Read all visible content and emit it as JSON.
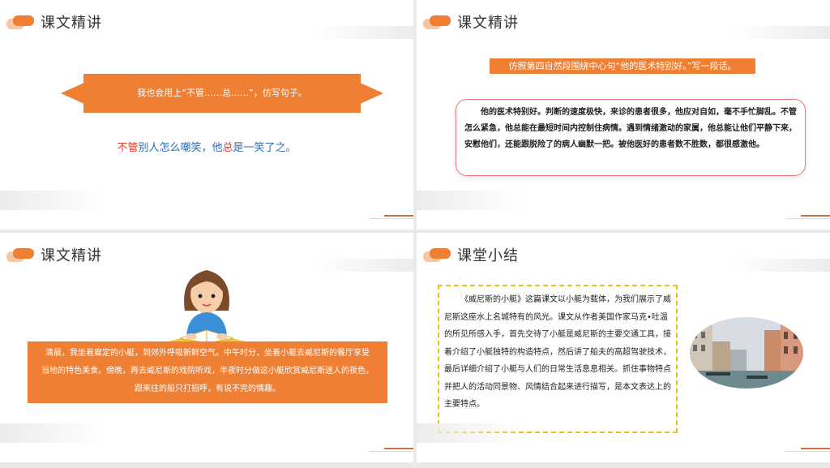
{
  "slides": [
    {
      "title": "课文精讲",
      "banner": "我也会用上“不管……总……”，仿写句子。",
      "sentence": {
        "p1": "不管",
        "p2": "别人怎么嘲笑，他",
        "p3": "总",
        "p4": "是一笑了之。"
      }
    },
    {
      "title": "课文精讲",
      "prompt": "仿照第四自然段围绕中心句“他的医术特别好。”写一段话。",
      "paragraph": "他的医术特别好。判断的速度极快，来诊的患者很多，他应对自如，毫不手忙脚乱。不管怎么紧急，他总能在最短时间内控制住病情。遇到情绪激动的家属，他总能让他们平静下来，安慰他们，还能跟脱险了的病人幽默一把。被他医好的患者数不胜数，都很感激他。"
    },
    {
      "title": "课文精讲",
      "passage": {
        "line1": "清晨，我坐着雇定的小艇，到郊外呼吸新鲜空气。中午时分，坐着小艇去威尼斯的餐厅享受",
        "line2": "当地的特色美食。傍晚，再去威尼斯的戏院听戏，半夜时分做这小艇欣赏威尼斯迷人的夜色，",
        "line3": "跟来往的船只打招呼，有说不完的情趣。"
      }
    },
    {
      "title": "课堂小结",
      "summary": "《威尼斯的小艇》这篇课文以小艇为载体，为我们展示了威尼斯这座水上名城特有的风光。课文从作者美国作家马克•吐温的所见所感入手，首先交待了小艇是威尼斯的主要交通工具，接着介绍了小艇独特的构造特点，然后讲了船夫的高超驾驶技术，最后详细介绍了小艇与人们的日常生活息息相关。抓住事物特点并把人的活动同景物、风情结合起来进行描写，是本文表达上的主要特点。"
    }
  ],
  "colors": {
    "accent": "#ee7f33",
    "keyword": "#e23b2e",
    "blue_text": "#2f6db3",
    "dashed_border": "#e8c21b"
  },
  "icons": {
    "logo": "orange-rounded-blocks-icon",
    "illustration": "girl-reading-book",
    "photo": "venice-canal-photo"
  }
}
